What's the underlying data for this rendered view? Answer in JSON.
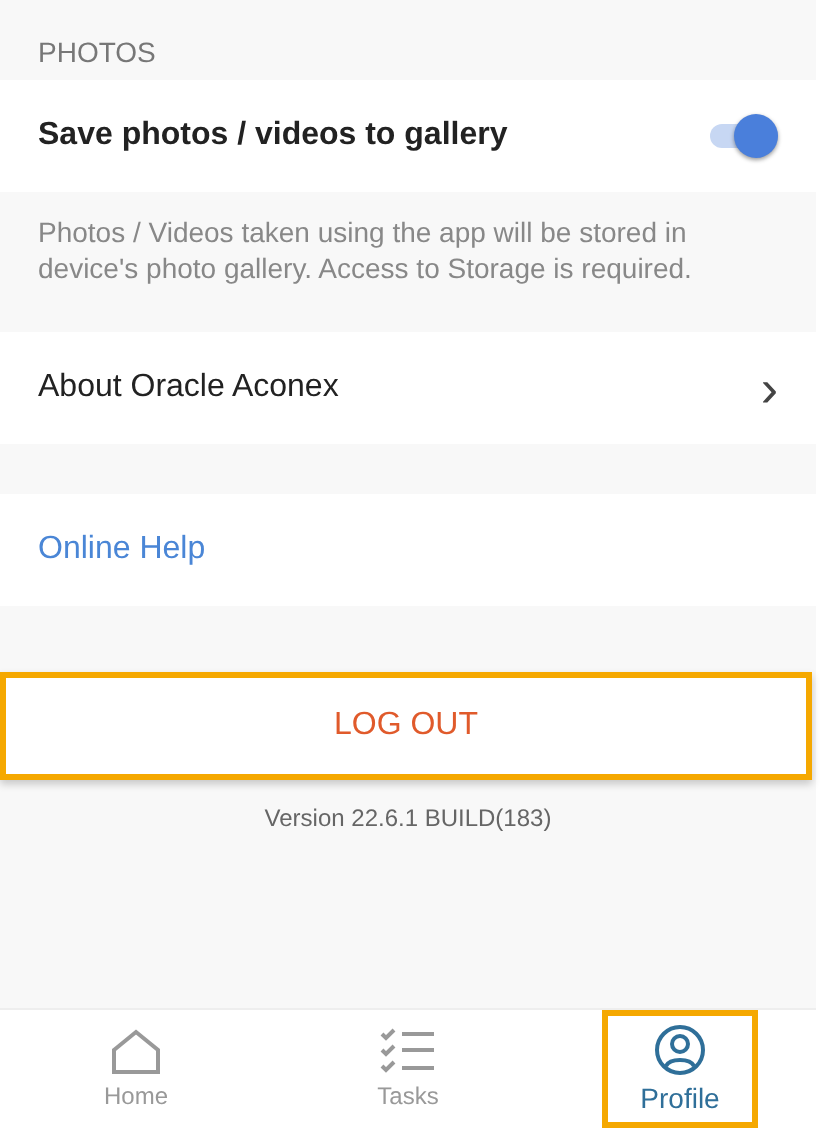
{
  "section_header": "PHOTOS",
  "save_setting": {
    "label": "Save photos / videos to gallery",
    "on": true
  },
  "description": "Photos / Videos taken using the app will be stored in device's photo gallery. Access to Storage is required.",
  "about": {
    "label": "About Oracle Aconex",
    "chevron": "›"
  },
  "online_help": "Online Help",
  "logout": {
    "label": "LOG OUT",
    "highlighted": true
  },
  "version": "Version 22.6.1 BUILD(183)",
  "nav": [
    {
      "label": "Home",
      "kind": "home",
      "selected": false,
      "highlighted": false
    },
    {
      "label": "Tasks",
      "kind": "tasks",
      "selected": false,
      "highlighted": false
    },
    {
      "label": "Profile",
      "kind": "profile",
      "selected": true,
      "highlighted": true
    }
  ]
}
